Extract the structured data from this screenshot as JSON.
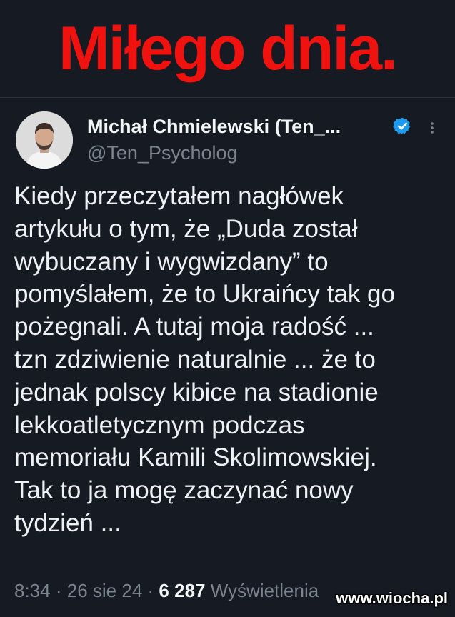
{
  "headline": "Miłego dnia.",
  "tweet": {
    "author_name": "Michał Chmielewski (Ten_...",
    "author_handle": "@Ten_Psycholog",
    "lines": [
      "Kiedy przeczytałem nagłówek",
      "artykułu o tym, że „Duda został",
      "wybuczany i wygwizdany” to",
      "pomyślałem, że to Ukraińcy tak go",
      "pożegnali. A tutaj moja radość ...",
      "tzn zdziwienie naturalnie ... że to",
      "jednak polscy kibice na stadionie",
      "lekkoatletycznym podczas",
      "memoriału Kamili Skolimowskiej.",
      "Tak to ja mogę zaczynać nowy",
      "tydzień ..."
    ],
    "time": "8:34",
    "separator": "·",
    "date": "26 sie 24",
    "views_count": "6 287",
    "views_label": "Wyświetlenia"
  },
  "watermark": "www.wiocha.pl",
  "colors": {
    "background": "#151a23",
    "headline": "#f0120e",
    "verified": "#1d9bf0",
    "muted_text": "#7a838e"
  },
  "icons": {
    "verified": "verified-badge-icon",
    "more": "more-options-icon"
  }
}
